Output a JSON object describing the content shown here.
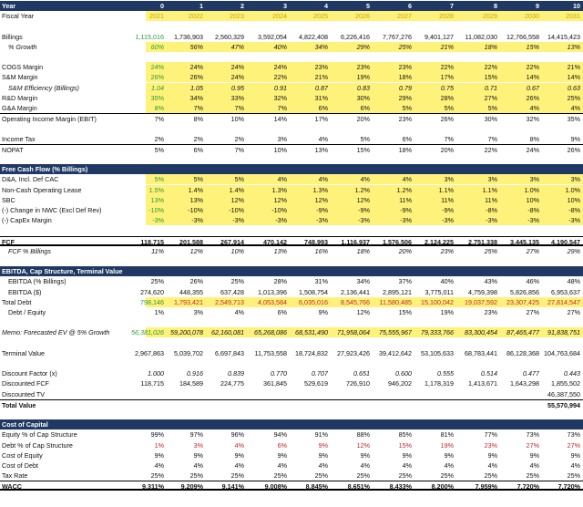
{
  "columns": [
    "0",
    "1",
    "2",
    "3",
    "4",
    "5",
    "6",
    "7",
    "8",
    "9",
    "10"
  ],
  "rows": [
    {
      "label": "Year",
      "style": "header",
      "values": [
        "0",
        "1",
        "2",
        "3",
        "4",
        "5",
        "6",
        "7",
        "8",
        "9",
        "10"
      ]
    },
    {
      "label": "Fiscal Year",
      "style": "year",
      "highlight": true,
      "values": [
        "2021",
        "2022",
        "2023",
        "2024",
        "2025",
        "2026",
        "2027",
        "2028",
        "2029",
        "2030",
        "2031"
      ]
    },
    {
      "label": "",
      "style": "blank"
    },
    {
      "label": "Billings",
      "style": "normal",
      "values": [
        "1,115,016",
        "1,736,903",
        "2,560,329",
        "3,592,054",
        "4,822,408",
        "6,226,416",
        "7,767,276",
        "9,401,127",
        "11,082,030",
        "12,766,558",
        "14,415,423"
      ],
      "firstColor": "green"
    },
    {
      "label": "% Growth",
      "style": "italic-indent",
      "highlight": true,
      "values": [
        "60%",
        "56%",
        "47%",
        "40%",
        "34%",
        "29%",
        "25%",
        "21%",
        "18%",
        "15%",
        "13%"
      ],
      "firstColor": "green"
    },
    {
      "label": "",
      "style": "blank"
    },
    {
      "label": "COGS Margin",
      "style": "normal",
      "highlight": true,
      "values": [
        "24%",
        "24%",
        "24%",
        "24%",
        "23%",
        "23%",
        "23%",
        "22%",
        "22%",
        "22%",
        "21%"
      ],
      "firstColor": "green"
    },
    {
      "label": "S&M Margin",
      "style": "normal",
      "highlight": true,
      "values": [
        "26%",
        "26%",
        "24%",
        "22%",
        "21%",
        "19%",
        "18%",
        "17%",
        "15%",
        "14%",
        "14%"
      ],
      "firstColor": "green"
    },
    {
      "label": "S&M Efficiency (Billings)",
      "style": "italic-indent",
      "highlight": true,
      "values": [
        "1.04",
        "1.05",
        "0.95",
        "0.91",
        "0.87",
        "0.83",
        "0.79",
        "0.75",
        "0.71",
        "0.67",
        "0.63"
      ],
      "firstColor": "green"
    },
    {
      "label": "R&D Margin",
      "style": "normal",
      "highlight": true,
      "values": [
        "35%",
        "34%",
        "33%",
        "32%",
        "31%",
        "30%",
        "29%",
        "28%",
        "27%",
        "26%",
        "25%"
      ],
      "firstColor": "green"
    },
    {
      "label": "G&A Margin",
      "style": "normal",
      "highlight": true,
      "values": [
        "8%",
        "7%",
        "7%",
        "7%",
        "6%",
        "6%",
        "5%",
        "5%",
        "5%",
        "4%",
        "4%"
      ],
      "firstColor": "green"
    },
    {
      "label": "Operating Income Margin (EBIT)",
      "style": "normal",
      "border": "top",
      "values": [
        "7%",
        "8%",
        "10%",
        "14%",
        "17%",
        "20%",
        "23%",
        "26%",
        "30%",
        "32%",
        "35%"
      ]
    },
    {
      "label": "",
      "style": "blank"
    },
    {
      "label": "Income Tax",
      "style": "normal",
      "values": [
        "2%",
        "2%",
        "2%",
        "3%",
        "4%",
        "5%",
        "6%",
        "7%",
        "7%",
        "8%",
        "9%"
      ]
    },
    {
      "label": "NOPAT",
      "style": "normal",
      "border": "top",
      "values": [
        "5%",
        "6%",
        "7%",
        "10%",
        "13%",
        "15%",
        "18%",
        "20%",
        "22%",
        "24%",
        "26%"
      ]
    },
    {
      "label": "",
      "style": "blank"
    },
    {
      "label": "Free Cash Flow (% Billings)",
      "style": "header"
    },
    {
      "label": "D&A, Incl. Def CAC",
      "style": "normal",
      "highlight": true,
      "values": [
        "5%",
        "5%",
        "5%",
        "4%",
        "4%",
        "4%",
        "4%",
        "3%",
        "3%",
        "3%",
        "3%"
      ],
      "firstColor": "green"
    },
    {
      "label": "Non-Cash Operating Lease",
      "style": "normal",
      "highlight": true,
      "values": [
        "1.5%",
        "1.4%",
        "1.4%",
        "1.3%",
        "1.3%",
        "1.2%",
        "1.2%",
        "1.1%",
        "1.1%",
        "1.0%",
        "1.0%"
      ],
      "firstColor": "green"
    },
    {
      "label": "SBC",
      "style": "normal",
      "highlight": true,
      "values": [
        "13%",
        "13%",
        "12%",
        "12%",
        "12%",
        "12%",
        "11%",
        "11%",
        "11%",
        "10%",
        "10%"
      ],
      "firstColor": "green"
    },
    {
      "label": "(-) Change in NWC (Excl Def Rev)",
      "style": "normal",
      "highlight": true,
      "values": [
        "-10%",
        "-10%",
        "-10%",
        "-10%",
        "-9%",
        "-9%",
        "-9%",
        "-9%",
        "-8%",
        "-8%",
        "-8%"
      ],
      "firstColor": "green"
    },
    {
      "label": "(-) CapEx Margin",
      "style": "normal",
      "highlight": true,
      "values": [
        "-3%",
        "-3%",
        "-3%",
        "-3%",
        "-3%",
        "-3%",
        "-3%",
        "-3%",
        "-3%",
        "-3%",
        "-3%"
      ],
      "firstColor": "green"
    },
    {
      "label": "",
      "style": "blank"
    },
    {
      "label": "FCF",
      "style": "bold",
      "border": "topbottom",
      "values": [
        "118,715",
        "201,588",
        "267,914",
        "470,142",
        "748,993",
        "1,116,937",
        "1,576,506",
        "2,124,225",
        "2,751,338",
        "3,445,135",
        "4,190,547"
      ]
    },
    {
      "label": "FCF % Billings",
      "style": "italic-indent",
      "values": [
        "11%",
        "12%",
        "10%",
        "13%",
        "16%",
        "18%",
        "20%",
        "23%",
        "25%",
        "27%",
        "29%"
      ]
    },
    {
      "label": "",
      "style": "blank"
    },
    {
      "label": "EBITDA, Cap Structure, Terminal Value",
      "style": "header"
    },
    {
      "label": "EBITDA (% Billings)",
      "style": "indent",
      "values": [
        "25%",
        "26%",
        "25%",
        "28%",
        "31%",
        "34%",
        "37%",
        "40%",
        "43%",
        "46%",
        "48%"
      ]
    },
    {
      "label": "EBITDA ($)",
      "style": "indent",
      "values": [
        "274,620",
        "448,355",
        "637,428",
        "1,013,396",
        "1,508,754",
        "2,136,441",
        "2,895,121",
        "3,775,011",
        "4,759,398",
        "5,826,856",
        "6,953,637"
      ]
    },
    {
      "label": "Total Debt",
      "style": "normal",
      "highlight": true,
      "values": [
        "798,146",
        "1,793,421",
        "2,549,713",
        "4,053,584",
        "6,035,016",
        "8,545,766",
        "11,580,485",
        "15,100,042",
        "19,037,592",
        "23,307,425",
        "27,814,547"
      ],
      "firstColor": "green",
      "color": "red"
    },
    {
      "label": "Debt / Equity",
      "style": "indent",
      "values": [
        "1%",
        "3%",
        "4%",
        "6%",
        "9%",
        "12%",
        "15%",
        "19%",
        "23%",
        "27%",
        "27%"
      ]
    },
    {
      "label": "",
      "style": "blank"
    },
    {
      "label": "Memo: Forecasted EV @ 5% Growth",
      "style": "italic",
      "highlight": true,
      "values": [
        "56,381,026",
        "59,200,078",
        "62,160,081",
        "65,268,086",
        "68,531,490",
        "71,958,064",
        "75,555,967",
        "79,333,766",
        "83,300,454",
        "87,465,477",
        "91,838,751"
      ],
      "firstColor": "green",
      "color": "italic"
    },
    {
      "label": "",
      "style": "blank"
    },
    {
      "label": "Terminal Value",
      "style": "normal",
      "values": [
        "2,967,863",
        "5,039,702",
        "6,697,843",
        "11,753,558",
        "18,724,832",
        "27,923,426",
        "39,412,642",
        "53,105,633",
        "68,783,441",
        "86,128,368",
        "104,763,684"
      ]
    },
    {
      "label": "",
      "style": "blank"
    },
    {
      "label": "Discount Factor (x)",
      "style": "normal",
      "values": [
        "1.000",
        "0.916",
        "0.839",
        "0.770",
        "0.707",
        "0.651",
        "0.600",
        "0.555",
        "0.514",
        "0.477",
        "0.443"
      ],
      "color": "italic"
    },
    {
      "label": "Discounted FCF",
      "style": "normal",
      "values": [
        "118,715",
        "184,589",
        "224,775",
        "361,845",
        "529,619",
        "726,910",
        "946,202",
        "1,178,319",
        "1,413,671",
        "1,643,298",
        "1,855,502"
      ]
    },
    {
      "label": "Discounted TV",
      "style": "normal",
      "values": [
        "",
        "",
        "",
        "",
        "",
        "",
        "",
        "",
        "",
        "",
        "46,387,550"
      ]
    },
    {
      "label": "Total Value",
      "style": "bold",
      "border": "top",
      "values": [
        "",
        "",
        "",
        "",
        "",
        "",
        "",
        "",
        "",
        "",
        "55,570,994"
      ]
    },
    {
      "label": "",
      "style": "blank"
    },
    {
      "label": "Cost of Capital",
      "style": "header"
    },
    {
      "label": "Equity % of Cap Structure",
      "style": "normal",
      "values": [
        "99%",
        "97%",
        "96%",
        "94%",
        "91%",
        "88%",
        "85%",
        "81%",
        "77%",
        "73%",
        "73%"
      ]
    },
    {
      "label": "Debt % of Cap Structure",
      "style": "normal",
      "values": [
        "1%",
        "3%",
        "4%",
        "6%",
        "9%",
        "12%",
        "15%",
        "19%",
        "23%",
        "27%",
        "27%"
      ],
      "color": "red"
    },
    {
      "label": "Cost of Equity",
      "style": "normal",
      "values": [
        "9%",
        "9%",
        "9%",
        "9%",
        "9%",
        "9%",
        "9%",
        "9%",
        "9%",
        "9%",
        "9%"
      ]
    },
    {
      "label": "Cost of Debt",
      "style": "normal",
      "values": [
        "4%",
        "4%",
        "4%",
        "4%",
        "4%",
        "4%",
        "4%",
        "4%",
        "4%",
        "4%",
        "4%"
      ]
    },
    {
      "label": "Tax Rate",
      "style": "normal",
      "values": [
        "25%",
        "25%",
        "25%",
        "25%",
        "25%",
        "25%",
        "25%",
        "25%",
        "25%",
        "25%",
        "25%"
      ]
    },
    {
      "label": "WACC",
      "style": "bold",
      "border": "topbottom",
      "values": [
        "9.311%",
        "9.209%",
        "9.141%",
        "9.008%",
        "8.845%",
        "8.651%",
        "8.433%",
        "8.200%",
        "7.959%",
        "7.720%",
        "7.720%"
      ]
    }
  ]
}
